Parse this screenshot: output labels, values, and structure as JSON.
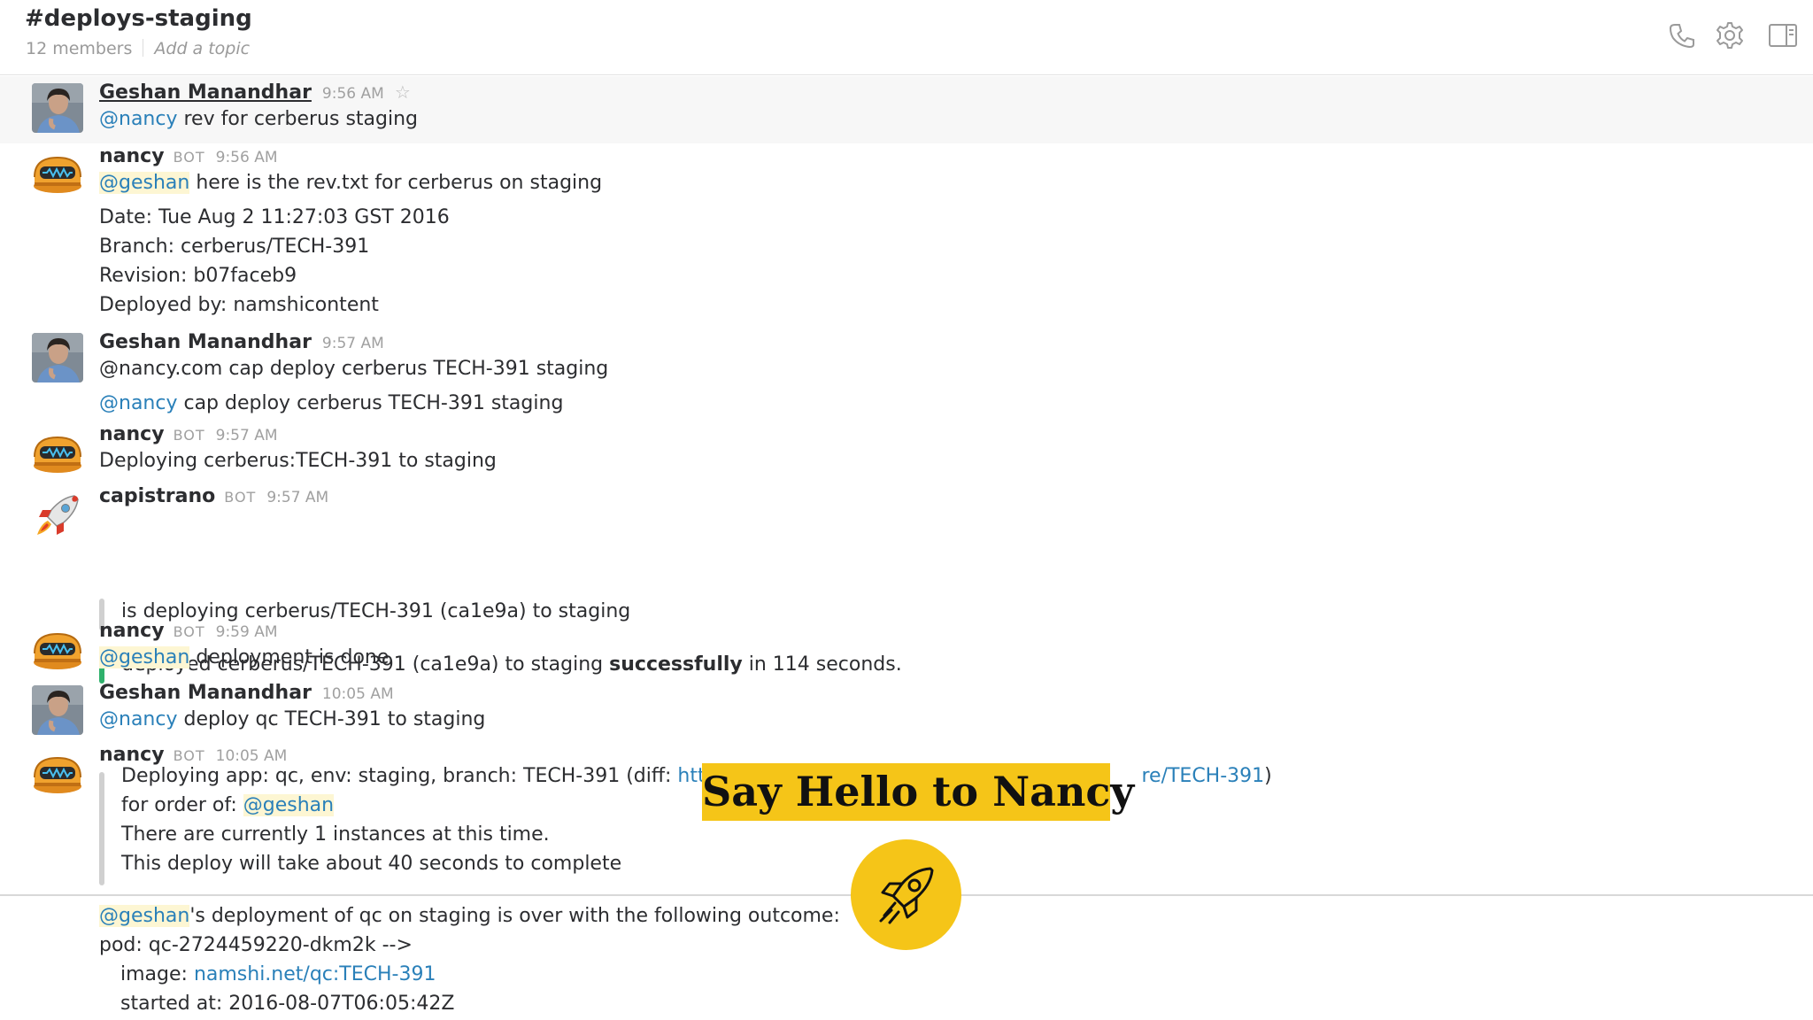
{
  "header": {
    "channel": "#deploys-staging",
    "members": "12 members",
    "topic": "Add a topic",
    "icons": [
      "phone-icon",
      "gear-icon",
      "sidebar-toggle-icon"
    ]
  },
  "messages": [
    {
      "sender": "Geshan Manandhar",
      "time": "9:56 AM",
      "mention": "@nancy",
      "text": " rev for cerberus staging"
    },
    {
      "sender": "nancy",
      "bot": "BOT",
      "time": "9:56 AM",
      "mention": "@geshan",
      "text": " here is the rev.txt for cerberus on staging",
      "lines": [
        "Date: Tue Aug 2 11:27:03 GST 2016",
        "Branch: cerberus/TECH-391",
        "Revision: b07faceb9",
        "Deployed by: namshicontent"
      ]
    },
    {
      "sender": "Geshan Manandhar",
      "time": "9:57 AM",
      "text": "@nancy.com cap deploy cerberus TECH-391 staging",
      "mention2": "@nancy",
      "text2": " cap deploy cerberus TECH-391 staging"
    },
    {
      "sender": "nancy",
      "bot": "BOT",
      "time": "9:57 AM",
      "text": "Deploying cerberus:TECH-391 to staging"
    },
    {
      "sender": "capistrano",
      "bot": "BOT",
      "time": "9:57 AM",
      "attach1": "is deploying cerberus/TECH-391 (ca1e9a) to staging",
      "attach2_a": "deployed cerberus/TECH-391 (ca1e9a) to staging ",
      "attach2_b": "successfully",
      "attach2_c": " in 114 seconds."
    },
    {
      "sender": "nancy",
      "bot": "BOT",
      "time": "9:59 AM",
      "mention": "@geshan",
      "text": " deployment is done"
    },
    {
      "sender": "Geshan Manandhar",
      "time": "10:05 AM",
      "mention": "@nancy",
      "text": " deploy qc TECH-391 to staging"
    },
    {
      "sender": "nancy",
      "bot": "BOT",
      "time": "10:05 AM",
      "a1_text": "Deploying app: qc, env: staging, branch: TECH-391 (diff: ",
      "a1_link_start": "https:",
      "a1_link_end": "re/TECH-391",
      "a1_close": ")",
      "a2_text": "for order of: ",
      "a2_mention": "@geshan",
      "a3": "There are currently 1 instances at this time.",
      "a4": "This deploy will take about 40 seconds to complete"
    }
  ],
  "footer_message": {
    "mention": "@geshan",
    "text": "'s deployment of qc on staging is over with the following outcome:",
    "pod": "pod: qc-2724459220-dkm2k -->",
    "image_label": "image: ",
    "image_link": "namshi.net/qc:TECH-391",
    "started": "started at: 2016-08-07T06:05:42Z"
  },
  "overlay": {
    "title": "Say Hello to Nancy",
    "icon": "rocket-icon"
  },
  "colors": {
    "accent_yellow": "#f5c518",
    "mention_blue": "#2a80b9",
    "attach_green": "#2fb16c",
    "attach_grey": "#d0d0d0",
    "bot_orange": "#f0a22e"
  }
}
